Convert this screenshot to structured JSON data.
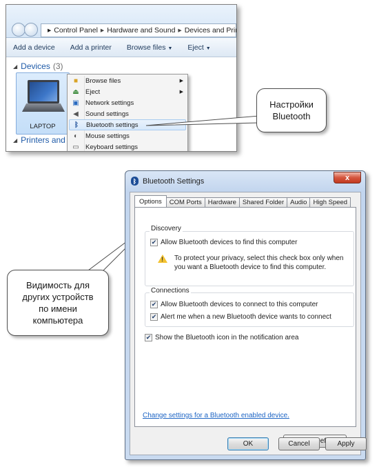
{
  "explorer": {
    "breadcrumb": [
      "Control Panel",
      "Hardware and Sound",
      "Devices and Printers"
    ],
    "breadcrumb_sep": "▸",
    "commands": [
      {
        "label": "Add a device",
        "dropdown": false
      },
      {
        "label": "Add a printer",
        "dropdown": false
      },
      {
        "label": "Browse files",
        "dropdown": true
      },
      {
        "label": "Eject",
        "dropdown": true
      }
    ],
    "devices_label": "Devices",
    "devices_count": "(3)",
    "device_name": "LAPTOP",
    "printers_label": "Printers and Fa",
    "context_menu": [
      {
        "label": "Browse files",
        "icon": "folder-icon",
        "submenu": true
      },
      {
        "label": "Eject",
        "icon": "eject-icon",
        "submenu": true
      },
      {
        "label": "Network settings",
        "icon": "network-icon",
        "submenu": false
      },
      {
        "label": "Sound settings",
        "icon": "speaker-icon",
        "submenu": false
      },
      {
        "label": "Bluetooth settings",
        "icon": "bluetooth-icon",
        "submenu": false,
        "highlighted": true
      },
      {
        "label": "Mouse settings",
        "icon": "mouse-icon",
        "submenu": false
      },
      {
        "label": "Keyboard settings",
        "icon": "keyboard-icon",
        "submenu": false
      }
    ]
  },
  "callouts": {
    "top": "Настройки\nBluetooth",
    "bottom": "Видимость для\nдругих устройств\nпо имени\nкомпьютера"
  },
  "dialog": {
    "title": "Bluetooth Settings",
    "close_glyph": "x",
    "tabs": [
      "Options",
      "COM Ports",
      "Hardware",
      "Shared Folder",
      "Audio",
      "High Speed"
    ],
    "active_tab": "Options",
    "discovery_title": "Discovery",
    "allow_find_label": "Allow Bluetooth devices to find this computer",
    "warning_text": "To protect your privacy, select this check box only when\nyou want a Bluetooth device to find this computer.",
    "connections_title": "Connections",
    "allow_connect_label": "Allow Bluetooth devices to connect to this computer",
    "alert_label": "Alert me when a new Bluetooth device wants to connect",
    "show_icon_label": "Show the Bluetooth icon in the notification area",
    "link_text": "Change settings for a Bluetooth enabled device.",
    "restore_label": "Restore Defaults",
    "ok_label": "OK",
    "cancel_label": "Cancel",
    "apply_label": "Apply",
    "check_glyph": "✔"
  },
  "colors": {
    "link": "#1c64c4",
    "header_blue": "#1e5aa8",
    "warning": "#f3c230"
  }
}
